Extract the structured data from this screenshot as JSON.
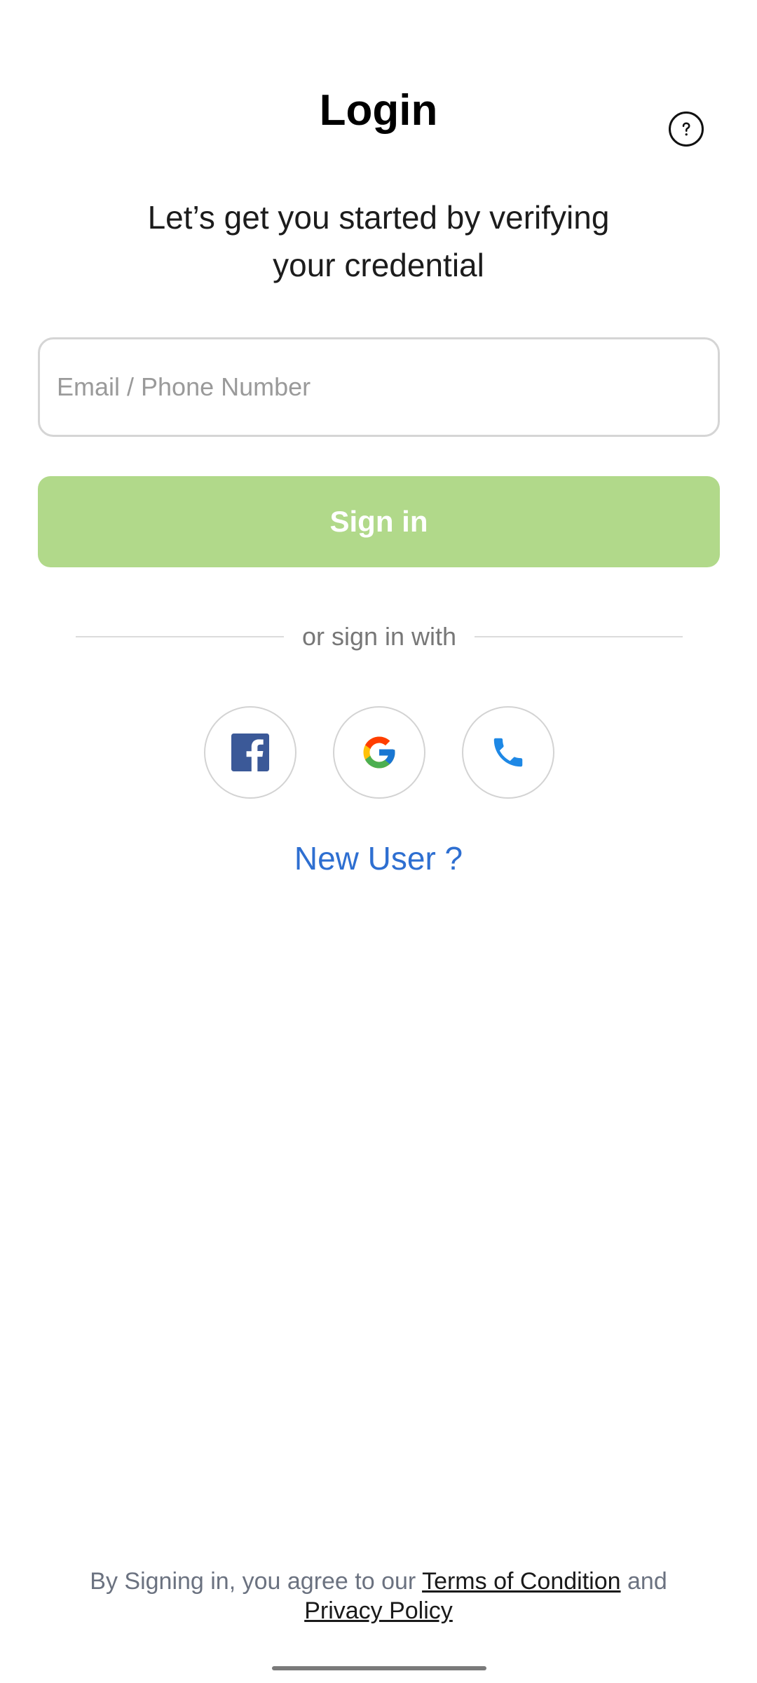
{
  "header": {
    "title": "Login",
    "help_icon": "help-circle-icon"
  },
  "subtitle": {
    "line1": "Let’s get you started by verifying",
    "line2": "your credential"
  },
  "form": {
    "email_placeholder": "Email / Phone Number",
    "email_value": "",
    "signin_label": "Sign in",
    "signin_color": "#b1d98a"
  },
  "divider": {
    "text": "or sign in with"
  },
  "social": [
    {
      "name": "facebook",
      "icon": "facebook-icon",
      "color": "#3b5998"
    },
    {
      "name": "google",
      "icon": "google-icon"
    },
    {
      "name": "phone",
      "icon": "phone-icon",
      "color": "#1e88e5"
    }
  ],
  "new_user_label": "New User ?",
  "footer": {
    "prefix": "By Signing in, you agree to our",
    "terms_label": "Terms of Condition",
    "conjunction": "and",
    "privacy_label": "Privacy Policy"
  },
  "colors": {
    "accent_link": "#2e6fd1",
    "text_muted": "#6b7280"
  }
}
